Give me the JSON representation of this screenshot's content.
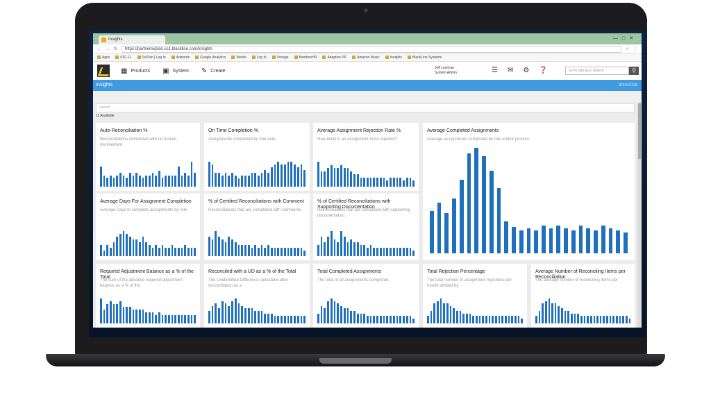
{
  "browser": {
    "tab_title": "Insights",
    "url": "https://partnerexplan.us1.blackline.com/insights",
    "bookmarks": [
      "Apps",
      "iOG FL",
      "SoPlan | Log In",
      "Adwords",
      "Google Analytics",
      "Webfo",
      "Log In",
      "Vonage",
      "BambooHR",
      "Adaptive PP",
      "Amazon Music",
      "Insights",
      "BlackLine Systems"
    ]
  },
  "header": {
    "nav": {
      "products": "Products",
      "system": "System",
      "create": "Create"
    },
    "user_name": "Jeff Lewman",
    "user_role": "System Admin",
    "search_placeholder": "Go to (all) go + Search"
  },
  "page": {
    "title": "Insights",
    "date": "9/30/2019",
    "filter_placeholder": "Search",
    "available_label": "11  Available"
  },
  "cards": [
    {
      "title": "Auto-Reconciliation %",
      "desc": "Reconciliations completed with no human involvement.",
      "values": [
        9,
        5,
        4,
        5,
        4,
        5,
        6,
        5,
        4,
        6,
        5,
        6,
        5,
        4,
        5,
        5,
        6,
        5,
        7,
        4,
        5,
        5,
        5,
        5,
        9,
        5,
        6,
        5,
        11,
        6
      ]
    },
    {
      "title": "On Time Completion %",
      "desc": "Assignments completed by due date.",
      "values": [
        9,
        8,
        5,
        5,
        4,
        5,
        4,
        5,
        4,
        3,
        4,
        4,
        4,
        5,
        5,
        4,
        5,
        6,
        5,
        7,
        8,
        9,
        8,
        8,
        9,
        9,
        8,
        7,
        8,
        6
      ]
    },
    {
      "title": "Average Assignment Rejection Rate %",
      "desc": "How likely is an assignment to be rejected?",
      "values": [
        8,
        5,
        5,
        6,
        7,
        6,
        6,
        7,
        6,
        6,
        5,
        4,
        4,
        3,
        3,
        3,
        3,
        3,
        3,
        3,
        3,
        2,
        3,
        3,
        3,
        3,
        2,
        3,
        3,
        2
      ]
    },
    {
      "title": "Average Completed Assignments",
      "desc": "Average assignments completed by role and/or product.",
      "values": [
        40,
        48,
        38,
        52,
        70,
        95,
        100,
        92,
        78,
        62,
        30,
        25,
        22,
        24,
        22,
        26,
        24,
        26,
        24,
        22,
        26,
        24,
        22,
        26,
        24,
        22,
        20
      ]
    },
    {
      "title": "Average Days For Assignment Completion",
      "desc": "Average Days to complete assignments by role.",
      "values": [
        4,
        2,
        4,
        3,
        5,
        7,
        8,
        9,
        8,
        7,
        6,
        6,
        5,
        7,
        5,
        4,
        3,
        4,
        3,
        4,
        3,
        3,
        4,
        3,
        3,
        3,
        4,
        3,
        3,
        3
      ]
    },
    {
      "title": "% of Certified Reconciliations with Comment",
      "desc": "Reconciliations that are completed with comments.",
      "values": [
        7,
        6,
        9,
        7,
        6,
        5,
        7,
        6,
        5,
        4,
        4,
        4,
        4,
        3,
        4,
        3,
        4,
        3,
        4,
        3,
        3,
        3,
        3,
        3,
        3,
        3,
        3,
        3,
        3,
        2
      ]
    },
    {
      "title": "% of Certified Reconciliations with Supporting Documentation",
      "desc": "Reconciliations that are completed with supporting documentation.",
      "values": [
        4,
        7,
        5,
        7,
        9,
        6,
        5,
        9,
        7,
        5,
        6,
        5,
        5,
        4,
        4,
        3,
        4,
        3,
        3,
        3,
        3,
        3,
        3,
        3,
        3,
        3,
        3,
        3,
        3,
        2
      ]
    },
    {
      "title": "Required Adjustment Balance as a % of the Total",
      "desc": "The sum of the absolute required adjustment balance as a % of the",
      "values": [
        9,
        5,
        7,
        8,
        7,
        7,
        8,
        6,
        6,
        6,
        5,
        5,
        5,
        5,
        4,
        4,
        4,
        3,
        4,
        3,
        3,
        3,
        3,
        3,
        3,
        3,
        3,
        3,
        3,
        3
      ]
    },
    {
      "title": "Reconciled with a UD as a % of the Total",
      "desc": "The Unidentified Difference calculated after reconciliation as a",
      "values": [
        5,
        7,
        8,
        6,
        9,
        8,
        7,
        9,
        10,
        8,
        7,
        6,
        6,
        6,
        5,
        5,
        5,
        4,
        4,
        4,
        3,
        3,
        3,
        3,
        3,
        3,
        3,
        3,
        3,
        3
      ]
    },
    {
      "title": "Total Completed Assignments",
      "desc": "The total of all assignments completed.",
      "values": [
        4,
        7,
        6,
        9,
        10,
        9,
        8,
        7,
        6,
        6,
        5,
        5,
        4,
        4,
        4,
        3,
        3,
        3,
        3,
        3,
        3,
        3,
        3,
        3,
        3,
        3,
        3,
        3,
        3,
        2
      ]
    },
    {
      "title": "Total Rejection Percentage",
      "desc": "The total number of assignment rejections per month divided by",
      "values": [
        3,
        5,
        8,
        9,
        10,
        8,
        8,
        7,
        6,
        5,
        5,
        4,
        4,
        4,
        3,
        3,
        3,
        3,
        3,
        3,
        3,
        3,
        3,
        3,
        3,
        3,
        3,
        3,
        3,
        2
      ]
    },
    {
      "title": "Average Number of Reconciling Items per Reconciliation",
      "desc": "The average number of reconciling items per",
      "values": [
        3,
        5,
        8,
        9,
        10,
        8,
        8,
        7,
        6,
        5,
        5,
        4,
        4,
        4,
        3,
        3,
        3,
        3,
        3,
        3,
        3,
        3,
        3,
        3,
        3,
        3,
        3,
        3,
        3,
        2
      ]
    }
  ],
  "colors": {
    "bar": "#1f6fbf",
    "titlebar": "#3f9ae0",
    "tabbar": "#9fc4a3"
  }
}
